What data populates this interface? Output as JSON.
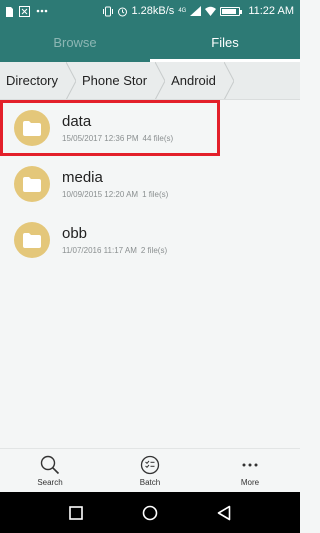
{
  "status_bar": {
    "speed": "1.28kB/s",
    "network": "4G",
    "time": "11:22 AM",
    "icons": [
      "sim-icon",
      "notification-icon",
      "more-notifications-icon",
      "vibrate-icon",
      "alarm-icon",
      "signal-icon",
      "wifi-icon",
      "battery-icon"
    ],
    "battery_level": 0.9
  },
  "tabs": [
    {
      "label": "Browse",
      "active": false
    },
    {
      "label": "Files",
      "active": true
    }
  ],
  "breadcrumb": [
    "Directory",
    "Phone Stor",
    "Android"
  ],
  "files": [
    {
      "name": "data",
      "date": "15/05/2017 12:36 PM",
      "count": "44 file(s)",
      "selected": true
    },
    {
      "name": "media",
      "date": "10/09/2015 12:20 AM",
      "count": "1 file(s)",
      "selected": false
    },
    {
      "name": "obb",
      "date": "11/07/2016 11:17 AM",
      "count": "2 file(s)",
      "selected": false
    }
  ],
  "toolbar": {
    "search_label": "Search",
    "batch_label": "Batch",
    "more_label": "More"
  },
  "colors": {
    "accent": "#2d7a75",
    "folder": "#e4c77a",
    "highlight": "#e3202a"
  }
}
